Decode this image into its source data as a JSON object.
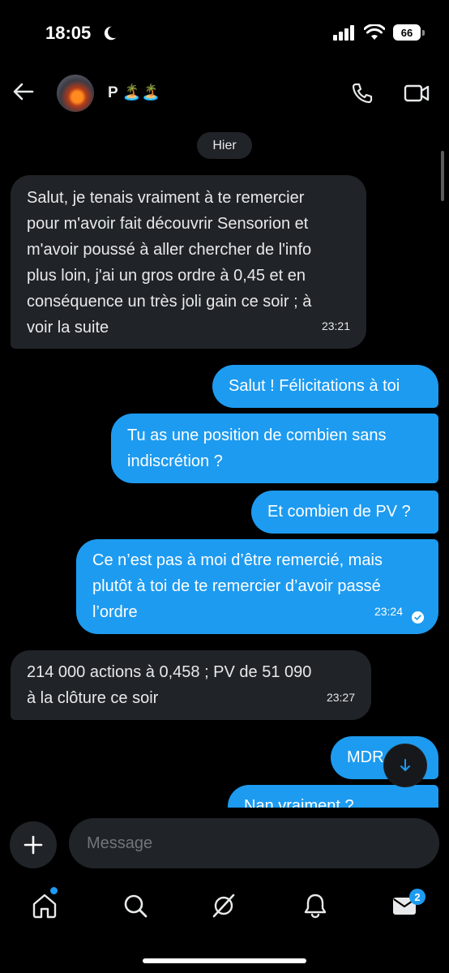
{
  "status_bar": {
    "time": "18:05",
    "battery": "66"
  },
  "header": {
    "contact_name": "P 🏝️🏝️"
  },
  "chat": {
    "date_divider": "Hier",
    "messages": [
      {
        "direction": "in",
        "lines": [
          "Salut, je tenais vraiment à te remercier",
          "pour m'avoir fait découvrir Sensorion et",
          "m'avoir poussé à aller chercher de l'info",
          "plus loin, j'ai un gros ordre à 0,45 et en",
          "conséquence un très joli gain ce soir ; à",
          "voir la suite"
        ],
        "time": "23:21"
      },
      {
        "direction": "out",
        "lines": [
          "Salut ! Félicitations à toi"
        ]
      },
      {
        "direction": "out",
        "lines": [
          "Tu as une position de combien sans",
          "indiscrétion ?"
        ]
      },
      {
        "direction": "out",
        "lines": [
          "Et combien de PV ?"
        ]
      },
      {
        "direction": "out",
        "lines": [
          "Ce n’est pas à moi d’être remercié, mais",
          "plutôt à toi de te remercier d’avoir passé",
          "l’ordre"
        ],
        "time": "23:24",
        "read": true
      },
      {
        "direction": "in",
        "lines": [
          "214 000 actions à 0,458 ; PV de 51 090",
          "à la clôture ce soir"
        ],
        "time": "23:27"
      },
      {
        "direction": "out",
        "lines": [
          "MDR"
        ]
      },
      {
        "direction": "out",
        "lines": [
          "Nan vraiment ?"
        ]
      }
    ]
  },
  "composer": {
    "placeholder": "Message"
  },
  "bottom_nav": {
    "messages_badge": "2"
  },
  "colors": {
    "accent": "#1d9bf0",
    "incoming_bubble": "#202327",
    "background": "#000000"
  },
  "icons": [
    "moon-icon",
    "signal-icon",
    "wifi-icon",
    "battery-icon",
    "back-arrow-icon",
    "phone-icon",
    "video-icon",
    "scroll-down-arrow-icon",
    "plus-icon",
    "home-icon",
    "search-icon",
    "grok-icon",
    "notifications-bell-icon",
    "messages-envelope-icon",
    "read-check-icon"
  ]
}
